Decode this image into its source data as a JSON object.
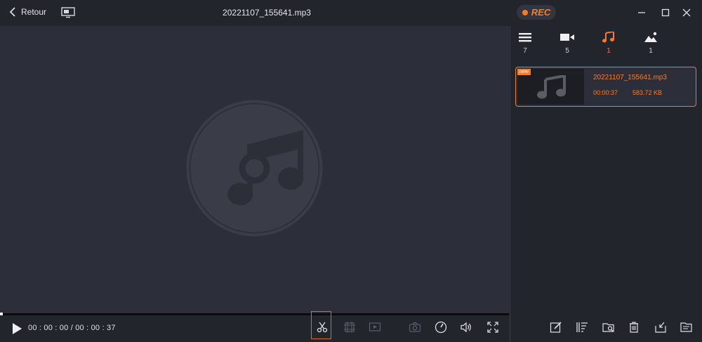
{
  "header": {
    "back_label": "Retour",
    "title": "20221107_155641.mp3",
    "rec_label": "REC"
  },
  "player": {
    "time_display": "00 : 00 : 00 / 00 : 00 : 37",
    "progress_fraction": 0.0
  },
  "sidebar": {
    "filters": [
      {
        "icon": "list-icon",
        "count": "7"
      },
      {
        "icon": "video-icon",
        "count": "5"
      },
      {
        "icon": "music-icon",
        "count": "1"
      },
      {
        "icon": "image-icon",
        "count": "1"
      }
    ],
    "files": [
      {
        "badge": "new",
        "name": "20221107_155641.mp3",
        "duration": "00:00:37",
        "size": "583.72 KB"
      }
    ]
  },
  "colors": {
    "accent": "#ff7a22",
    "background": "#23252d",
    "panel": "#2c2f39"
  }
}
